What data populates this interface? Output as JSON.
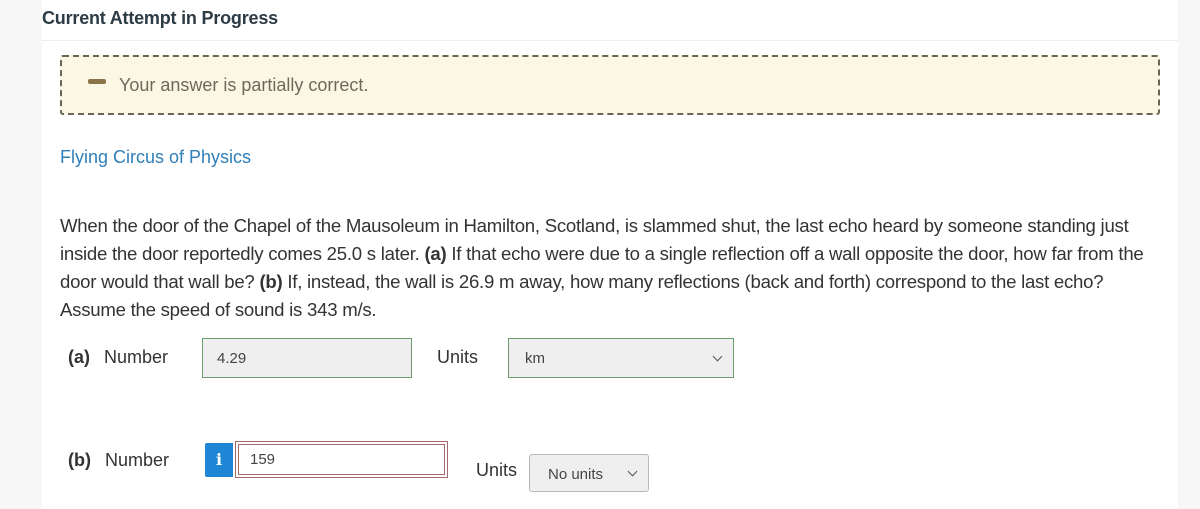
{
  "header": {
    "title": "Current Attempt in Progress"
  },
  "feedback": {
    "icon": "partial-credit-dash-icon",
    "message": "Your answer is partially correct."
  },
  "source": {
    "label": "Flying Circus of Physics"
  },
  "question": {
    "seg1": "When the door of the Chapel of the Mausoleum in Hamilton, Scotland, is slammed shut, the last echo heard by someone standing just inside the door reportedly comes 25.0 s later. ",
    "part_a_tag": "(a)",
    "seg2": " If that echo were due to a single reflection off a wall opposite the door, how far from the door would that wall be? ",
    "part_b_tag": "(b)",
    "seg3": " If, instead, the wall is 26.9 m away, how many reflections (back and forth) correspond to the last echo? Assume the speed of sound is 343 m/s."
  },
  "parts": [
    {
      "tag": "(a)",
      "number_label": "Number",
      "value": "4.29",
      "units_label": "Units",
      "units_value": "km",
      "status": "correct"
    },
    {
      "tag": "(b)",
      "number_label": "Number",
      "value": "159",
      "info_icon": "i",
      "units_label": "Units",
      "units_value": "No units",
      "status": "incorrect"
    }
  ],
  "colors": {
    "correct_border": "#6d9c6d",
    "incorrect_border": "#a76a6a",
    "info_blue": "#1f86d6",
    "link": "#2f7fb8",
    "feedback_bg": "#fcf7e5"
  }
}
